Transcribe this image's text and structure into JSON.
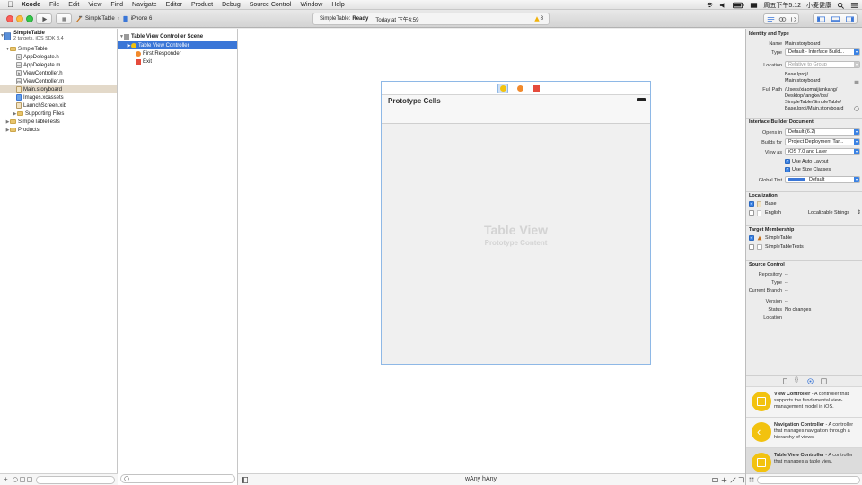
{
  "menubar": {
    "app": "Xcode",
    "items": [
      "File",
      "Edit",
      "View",
      "Find",
      "Navigate",
      "Editor",
      "Product",
      "Debug",
      "Source Control",
      "Window",
      "Help"
    ],
    "clock": "周五下午5:12",
    "user": "小麦健康"
  },
  "toolbar": {
    "scheme": "SimpleTable",
    "separator": "›",
    "device": "iPhone 6",
    "status_project": "SimpleTable:",
    "status_state": "Ready",
    "status_time": "Today at 下午4:59",
    "warning_count": "8"
  },
  "navigator": {
    "project": "SimpleTable",
    "project_sub": "2 targets, iOS SDK 8.4",
    "items": [
      {
        "label": "SimpleTable",
        "kind": "folder"
      },
      {
        "label": "AppDelegate.h",
        "kind": "h"
      },
      {
        "label": "AppDelegate.m",
        "kind": "m"
      },
      {
        "label": "ViewController.h",
        "kind": "h"
      },
      {
        "label": "ViewController.m",
        "kind": "m"
      },
      {
        "label": "Main.storyboard",
        "kind": "sb"
      },
      {
        "label": "Images.xcassets",
        "kind": "xc"
      },
      {
        "label": "LaunchScreen.xib",
        "kind": "xib"
      },
      {
        "label": "Supporting Files",
        "kind": "folder"
      },
      {
        "label": "SimpleTableTests",
        "kind": "folder"
      },
      {
        "label": "Products",
        "kind": "folder"
      }
    ]
  },
  "outline": {
    "scene": "Table View Controller Scene",
    "items": [
      "Table View Controller",
      "First Responder",
      "Exit"
    ]
  },
  "canvas": {
    "prototype_cells": "Prototype Cells",
    "table_view": "Table View",
    "prototype_content": "Prototype Content",
    "size_class": "wAny hAny"
  },
  "inspector": {
    "identity": {
      "header": "Identity and Type",
      "name_label": "Name",
      "name": "Main.storyboard",
      "type_label": "Type",
      "type": "Default - Interface Build...",
      "location_label": "Location",
      "location": "Relative to Group",
      "location_path1": "Base.lproj/",
      "location_path2": "Main.storyboard",
      "fullpath_label": "Full Path",
      "fullpath": [
        "/Users/xiaomaijiankang/",
        "Desktop/tangke/ios/",
        "SimpleTable/SimpleTable/",
        "Base.lproj/Main.storyboard"
      ]
    },
    "ibdoc": {
      "header": "Interface Builder Document",
      "opens_label": "Opens in",
      "opens": "Default (6.2)",
      "builds_label": "Builds for",
      "builds": "Project Deployment Tar...",
      "view_label": "View as",
      "view": "iOS 7.0 and Later",
      "autolayout": "Use Auto Layout",
      "sizeclasses": "Use Size Classes",
      "tint_label": "Global Tint",
      "tint": "Default",
      "tint_color": "#3a76d7"
    },
    "localization": {
      "header": "Localization",
      "base": "Base",
      "english": "English",
      "english_type": "Localizable Strings"
    },
    "target": {
      "header": "Target Membership",
      "t1": "SimpleTable",
      "t2": "SimpleTableTests"
    },
    "source": {
      "header": "Source Control",
      "repo_label": "Repository",
      "repo": "--",
      "type_label": "Type",
      "type": "--",
      "branch_label": "Current Branch",
      "branch": "--",
      "version_label": "Version",
      "version": "--",
      "status_label": "Status",
      "status": "No changes",
      "location_label": "Location"
    },
    "library": [
      {
        "title": "View Controller",
        "desc": " - A controller that supports the fundamental view-management model in iOS."
      },
      {
        "title": "Navigation Controller",
        "desc": " - A controller that manages navigation through a hierarchy of views."
      },
      {
        "title": "Table View Controller",
        "desc": " - A controller that manages a table view."
      }
    ]
  }
}
